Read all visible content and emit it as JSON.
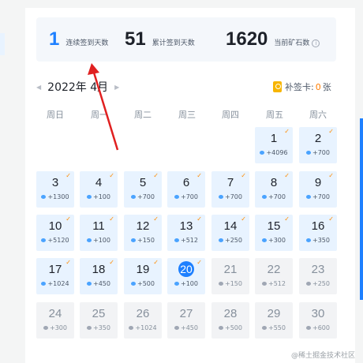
{
  "stats": {
    "consecutive_value": "1",
    "consecutive_label": "连续签到天数",
    "total_value": "51",
    "total_label": "累计签到天数",
    "ore_value": "1620",
    "ore_label": "当前矿石数",
    "info_icon": "i"
  },
  "calendar": {
    "month_label": "2022年 4月",
    "prev_icon": "◀",
    "next_icon": "▶",
    "makeup_label": "补签卡:",
    "makeup_count": "0",
    "makeup_unit": "张",
    "weekdays": [
      "周日",
      "周一",
      "周二",
      "周三",
      "周四",
      "周五",
      "周六"
    ],
    "today": "20",
    "days": [
      {
        "day": "1",
        "points": "+4096",
        "signed": true
      },
      {
        "day": "2",
        "points": "+700",
        "signed": true
      },
      {
        "day": "3",
        "points": "+1300",
        "signed": true
      },
      {
        "day": "4",
        "points": "+100",
        "signed": true
      },
      {
        "day": "5",
        "points": "+700",
        "signed": true
      },
      {
        "day": "6",
        "points": "+700",
        "signed": true
      },
      {
        "day": "7",
        "points": "+700",
        "signed": true
      },
      {
        "day": "8",
        "points": "+700",
        "signed": true
      },
      {
        "day": "9",
        "points": "+700",
        "signed": true
      },
      {
        "day": "10",
        "points": "+5120",
        "signed": true
      },
      {
        "day": "11",
        "points": "+100",
        "signed": true
      },
      {
        "day": "12",
        "points": "+150",
        "signed": true
      },
      {
        "day": "13",
        "points": "+512",
        "signed": true
      },
      {
        "day": "14",
        "points": "+250",
        "signed": true
      },
      {
        "day": "15",
        "points": "+300",
        "signed": true
      },
      {
        "day": "16",
        "points": "+350",
        "signed": true
      },
      {
        "day": "17",
        "points": "+1024",
        "signed": true
      },
      {
        "day": "18",
        "points": "+450",
        "signed": true
      },
      {
        "day": "19",
        "points": "+500",
        "signed": true
      },
      {
        "day": "20",
        "points": "+100",
        "signed": true
      },
      {
        "day": "21",
        "points": "+150",
        "signed": false
      },
      {
        "day": "22",
        "points": "+512",
        "signed": false
      },
      {
        "day": "23",
        "points": "+250",
        "signed": false
      },
      {
        "day": "24",
        "points": "+300",
        "signed": false
      },
      {
        "day": "25",
        "points": "+350",
        "signed": false
      },
      {
        "day": "26",
        "points": "+1024",
        "signed": false
      },
      {
        "day": "27",
        "points": "+450",
        "signed": false
      },
      {
        "day": "28",
        "points": "+500",
        "signed": false
      },
      {
        "day": "29",
        "points": "+550",
        "signed": false
      },
      {
        "day": "30",
        "points": "+600",
        "signed": false
      }
    ]
  },
  "icons": {
    "ore": "ore-icon",
    "check": "check-icon",
    "makeup": "makeup-card-icon"
  },
  "colors": {
    "accent": "#1e80ff",
    "signed_bg": "#e8f3ff",
    "future_bg": "#f2f3f5",
    "check": "#ff8a00",
    "annotation": "#e02020"
  },
  "watermark": "@稀土掘金技术社区"
}
